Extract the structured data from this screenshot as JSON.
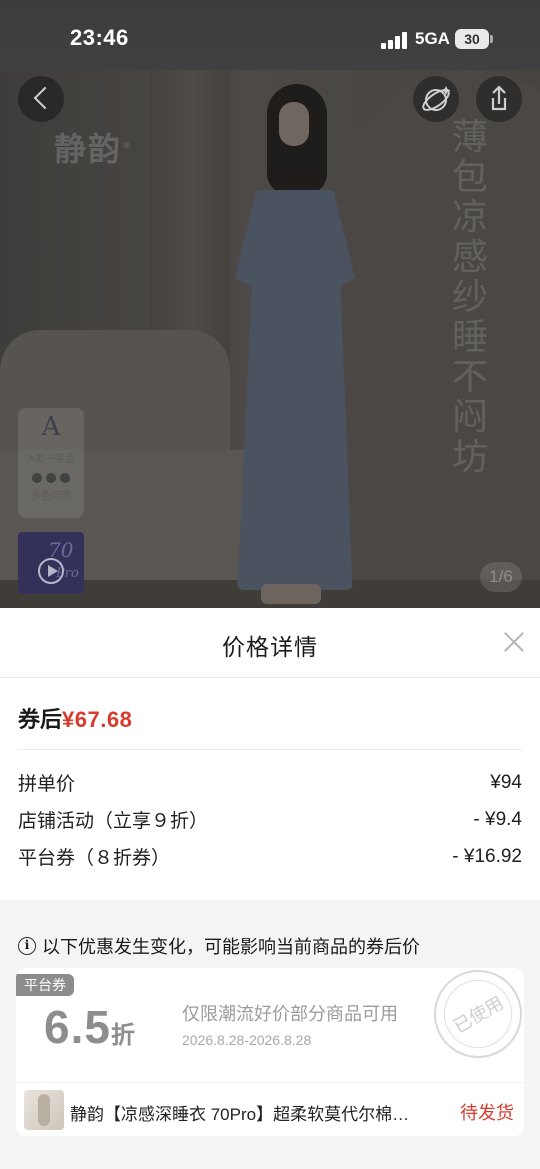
{
  "status_bar": {
    "time": "23:46",
    "network": "5GA",
    "battery": "30"
  },
  "hero": {
    "brand_watermark": "静韵",
    "brand_mark": "®",
    "slogan_vertical": "薄包凉感纱睡不闷坊",
    "grade_badge": {
      "letter": "A",
      "grade_text": "A类一等品",
      "colors_text": "多色可选"
    },
    "video_tag": {
      "number": "70",
      "suffix": "Pro"
    },
    "image_counter": "1/6"
  },
  "sheet": {
    "title": "价格详情",
    "after_coupon_label": "券后",
    "after_coupon_price": "¥67.68",
    "rows": [
      {
        "label": "拼单价",
        "value": "¥94"
      },
      {
        "label": "店铺活动（立享９折）",
        "value": "- ¥9.4"
      },
      {
        "label": "平台券（８折券）",
        "value": "- ¥16.92"
      }
    ],
    "notice": "以下优惠发生变化，可能影响当前商品的券后价",
    "coupon": {
      "tag": "平台券",
      "discount_value": "6.5",
      "discount_unit": "折",
      "description": "仅限潮流好价部分商品可用",
      "date_range": "2026.8.28-2026.8.28",
      "stamp": "已使用",
      "product_name": "静韵【凉感深睡衣 70Pro】超柔软莫代尔棉…",
      "order_status": "待发货"
    }
  },
  "colors": {
    "accent_red": "#d83a2e",
    "overlay": "#4a4a4a"
  }
}
